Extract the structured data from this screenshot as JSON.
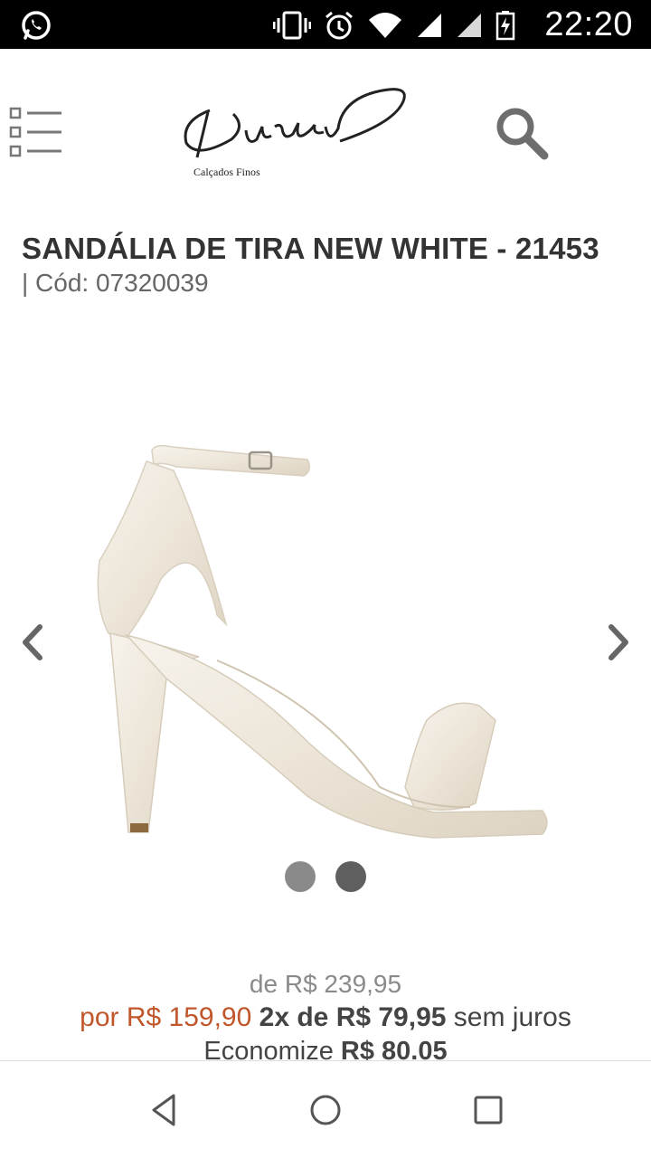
{
  "status_bar": {
    "time": "22:20",
    "left_icon": "whatsapp-icon",
    "icons": [
      "vibrate-icon",
      "alarm-icon",
      "wifi-icon",
      "signal-icon",
      "signal-icon",
      "battery-icon"
    ]
  },
  "header": {
    "menu_icon": "list-menu-icon",
    "logo_text": "Durval",
    "logo_subtitle": "Calçados Finos",
    "search_icon": "search-icon"
  },
  "product": {
    "title": "SANDÁLIA DE TIRA NEW WHITE - 21453",
    "code": "| Cód: 07320039",
    "image_alt": "sandal-image"
  },
  "carousel": {
    "prev_icon": "chevron-left-icon",
    "next_icon": "chevron-right-icon",
    "dots_count": 2,
    "active_dot": 1
  },
  "pricing": {
    "old_price": "de R$ 239,95",
    "current_price": "por R$ 159,90",
    "installments": "2x de R$ 79,95",
    "installments_suffix": "sem juros",
    "economize_label": "Economize",
    "economize_value": "R$ 80.05"
  },
  "colors": {
    "accent_price": "#c0562a",
    "text": "#333333",
    "muted": "#8a8a8a"
  },
  "nav_bar": {
    "back_icon": "back-triangle-icon",
    "home_icon": "home-circle-icon",
    "recent_icon": "recent-square-icon"
  }
}
